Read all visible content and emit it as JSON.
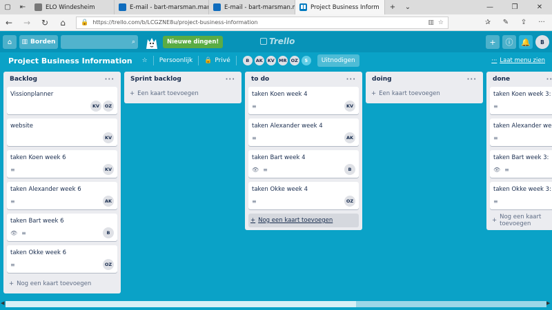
{
  "browser": {
    "tabs": [
      {
        "title": "ELO Windesheim",
        "icon": "elo-icon",
        "active": false
      },
      {
        "title": "E-mail - bart-marsman.mar",
        "icon": "outlook-icon",
        "active": false
      },
      {
        "title": "E-mail - bart-marsman.mar",
        "icon": "outlook-icon",
        "active": false
      },
      {
        "title": "Project Business Inform",
        "icon": "trello-icon",
        "active": true
      }
    ],
    "url": "https://trello.com/b/LCGZNE8u/project-business-information"
  },
  "header": {
    "boards_label": "Borden",
    "search_placeholder": "",
    "new_things_label": "Nieuwe dingen!",
    "logo_text": "Trello",
    "user_initials": "B"
  },
  "board": {
    "title": "Project Business Information",
    "visibility_team": "Persoonlijk",
    "visibility_private": "Privé",
    "members": [
      "B",
      "AK",
      "KV",
      "MR",
      "OZ"
    ],
    "extra_members": "5",
    "invite_label": "Uitnodigen",
    "menu_label": "Laat menu zien"
  },
  "lists": [
    {
      "title": "Backlog",
      "add_label": "Nog een kaart toevoegen",
      "cards": [
        {
          "title": "Vissionplanner",
          "watch": false,
          "desc": false,
          "members": [
            "KV",
            "OZ"
          ]
        },
        {
          "title": "website",
          "watch": false,
          "desc": false,
          "members": [
            "KV"
          ]
        },
        {
          "title": "taken Koen week 6",
          "watch": false,
          "desc": true,
          "members": [
            "KV"
          ]
        },
        {
          "title": "taken Alexander week 6",
          "watch": false,
          "desc": true,
          "members": [
            "AK"
          ]
        },
        {
          "title": "taken Bart week 6",
          "watch": true,
          "desc": true,
          "members": [
            "B"
          ]
        },
        {
          "title": "taken Okke week 6",
          "watch": false,
          "desc": true,
          "members": [
            "OZ"
          ]
        }
      ]
    },
    {
      "title": "Sprint backlog",
      "add_label": "Een kaart toevoegen",
      "cards": []
    },
    {
      "title": "to do",
      "add_label": "Nog een kaart toevoegen",
      "cards": [
        {
          "title": "taken Koen week 4",
          "watch": false,
          "desc": true,
          "members": [
            "KV"
          ]
        },
        {
          "title": "taken Alexander week 4",
          "watch": false,
          "desc": true,
          "members": [
            "AK"
          ]
        },
        {
          "title": "taken Bart week 4",
          "watch": true,
          "desc": true,
          "members": [
            "B"
          ]
        },
        {
          "title": "taken Okke week 4",
          "watch": false,
          "desc": true,
          "members": [
            "OZ"
          ]
        }
      ]
    },
    {
      "title": "doing",
      "add_label": "Een kaart toevoegen",
      "cards": []
    },
    {
      "title": "done",
      "add_label": "Nog een kaart toevoegen",
      "cards": [
        {
          "title": "taken Koen week 3:",
          "watch": false,
          "desc": true,
          "members": []
        },
        {
          "title": "taken Alexander week",
          "watch": false,
          "desc": true,
          "members": []
        },
        {
          "title": "taken Bart week 3:",
          "watch": true,
          "desc": true,
          "members": []
        },
        {
          "title": "taken Okke week 3:",
          "watch": false,
          "desc": true,
          "members": []
        }
      ]
    }
  ]
}
